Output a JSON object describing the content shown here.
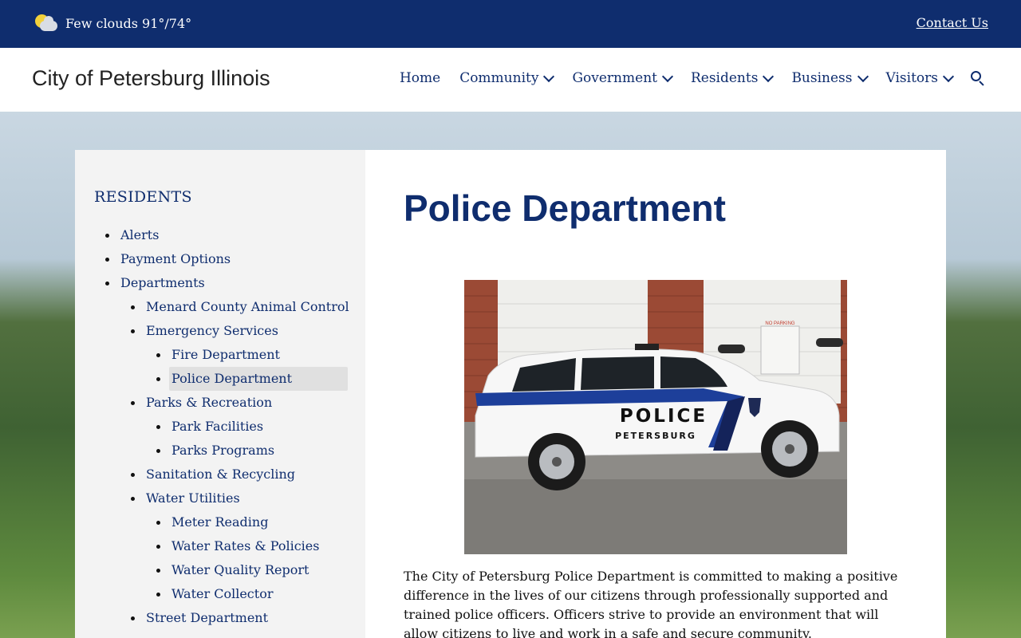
{
  "topbar": {
    "weather": "Few clouds 91°/74°",
    "contact": "Contact Us"
  },
  "header": {
    "site_title": "City of Petersburg Illinois",
    "nav": [
      "Home",
      "Community",
      "Government",
      "Residents",
      "Business",
      "Visitors"
    ],
    "search_icon": "search-icon"
  },
  "sidebar": {
    "heading": "RESIDENTS",
    "items": [
      {
        "label": "Alerts",
        "level": 1
      },
      {
        "label": "Payment Options",
        "level": 1
      },
      {
        "label": "Departments",
        "level": 1
      },
      {
        "label": "Menard County Animal Control",
        "level": 2
      },
      {
        "label": "Emergency Services",
        "level": 2
      },
      {
        "label": "Fire Department",
        "level": 3
      },
      {
        "label": "Police Department",
        "level": 3,
        "active": true
      },
      {
        "label": "Parks & Recreation",
        "level": 2
      },
      {
        "label": "Park Facilities",
        "level": 3
      },
      {
        "label": "Parks Programs",
        "level": 3
      },
      {
        "label": "Sanitation & Recycling",
        "level": 2
      },
      {
        "label": "Water Utilities",
        "level": 2
      },
      {
        "label": "Meter Reading",
        "level": 3
      },
      {
        "label": "Water Rates & Policies",
        "level": 3
      },
      {
        "label": "Water Quality Report",
        "level": 3
      },
      {
        "label": "Water Collector",
        "level": 3
      },
      {
        "label": "Street Department",
        "level": 2
      }
    ]
  },
  "main": {
    "title": "Police Department",
    "photo": {
      "car_text_1": "POLICE",
      "car_text_2": "PETERSBURG",
      "sign_text": "NO PARKING"
    },
    "intro": "The City of Petersburg Police Department is committed to making a positive difference in the lives of our citizens through professionally supported and trained police officers. Officers strive to provide an environment that will allow citizens to live and work in a safe and secure community."
  }
}
